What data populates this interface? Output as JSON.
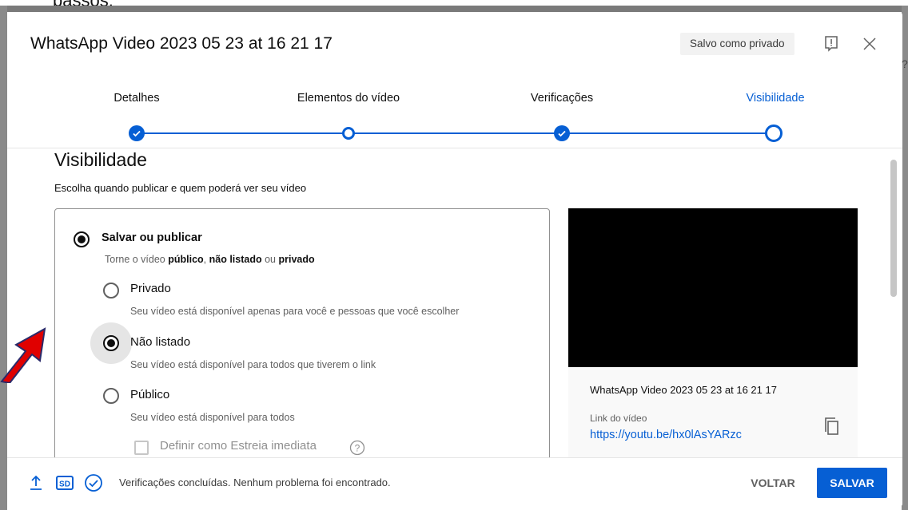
{
  "background": {
    "partial_text": "passos."
  },
  "dialog": {
    "title": "WhatsApp Video 2023 05 23 at 16 21 17",
    "saved_badge": "Salvo como privado",
    "icons": {
      "feedback": "feedback-icon",
      "close": "close-icon"
    }
  },
  "stepper": {
    "steps": [
      {
        "label": "Detalhes",
        "state": "done"
      },
      {
        "label": "Elementos do vídeo",
        "state": "visited"
      },
      {
        "label": "Verificações",
        "state": "done"
      },
      {
        "label": "Visibilidade",
        "state": "current"
      }
    ],
    "accent": "#065fd4"
  },
  "visibility": {
    "title": "Visibilidade",
    "description": "Escolha quando publicar e quem poderá ver seu vídeo",
    "save_publish": {
      "label": "Salvar ou publicar",
      "sub_prefix": "Torne o vídeo ",
      "sub_public": "público",
      "sub_sep1": ", ",
      "sub_unlisted": "não listado",
      "sub_sep2": " ou ",
      "sub_private": "privado"
    },
    "options": [
      {
        "label": "Privado",
        "description": "Seu vídeo está disponível apenas para você e pessoas que você escolher",
        "selected": false
      },
      {
        "label": "Não listado",
        "description": "Seu vídeo está disponível para todos que tiverem o link",
        "selected": true
      },
      {
        "label": "Público",
        "description": "Seu vídeo está disponível para todos",
        "selected": false
      }
    ],
    "premiere_label": "Definir como Estreia imediata"
  },
  "preview": {
    "video_title": "WhatsApp Video 2023 05 23 at 16 21 17",
    "link_label": "Link do vídeo",
    "link_url": "https://youtu.be/hx0lAsYARzc"
  },
  "footer": {
    "status": "Verificações concluídas. Nenhum problema foi encontrado.",
    "sd_badge": "SD",
    "back_label": "VOLTAR",
    "save_label": "SALVAR"
  },
  "annotation": {
    "arrow_color": "#e00000"
  }
}
